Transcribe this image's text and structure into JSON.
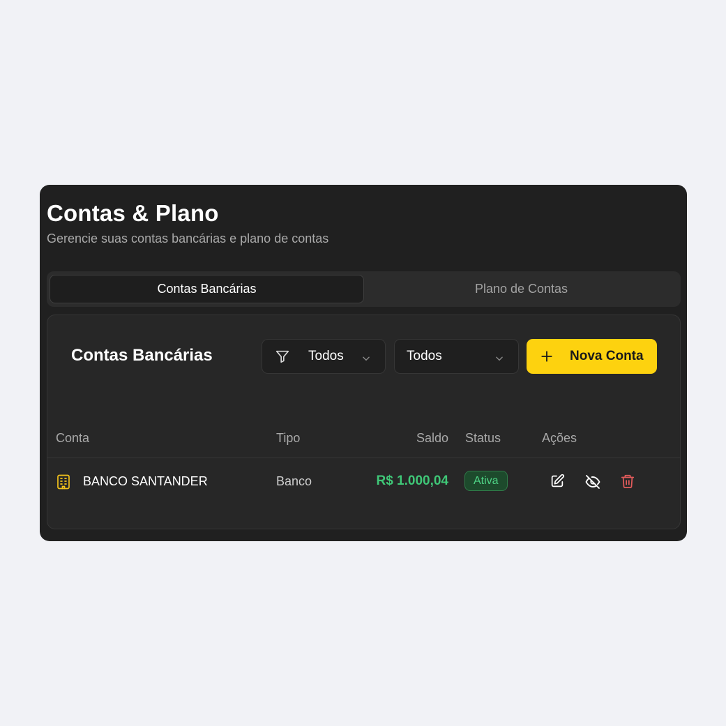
{
  "header": {
    "title": "Contas & Plano",
    "subtitle": "Gerencie suas contas bancárias e plano de contas"
  },
  "tabs": [
    {
      "label": "Contas Bancárias",
      "active": true
    },
    {
      "label": "Plano de Contas",
      "active": false
    }
  ],
  "card": {
    "title": "Contas Bancárias",
    "filter_select": {
      "value": "Todos",
      "icon": "filter-icon"
    },
    "second_select": {
      "value": "Todos"
    },
    "new_button": {
      "label": "Nova Conta",
      "icon": "plus-icon"
    }
  },
  "table": {
    "columns": [
      "Conta",
      "Tipo",
      "Saldo",
      "Status",
      "Ações"
    ],
    "rows": [
      {
        "conta": "BANCO SANTANDER",
        "tipo": "Banco",
        "saldo": "R$ 1.000,04",
        "status": "Ativa",
        "icon": "building-icon",
        "actions": [
          "edit-icon",
          "eye-off-icon",
          "trash-icon"
        ]
      }
    ]
  },
  "colors": {
    "accent": "#fdd20f",
    "positive": "#3fc777",
    "danger": "#e25b5b",
    "panel": "#202020"
  }
}
